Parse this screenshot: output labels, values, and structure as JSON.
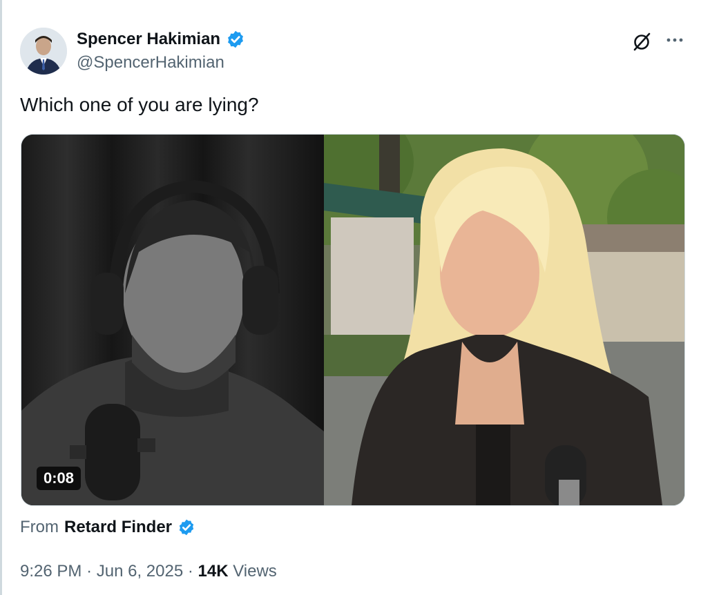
{
  "author": {
    "display_name": "Spencer Hakimian",
    "handle": "@SpencerHakimian",
    "verified": true
  },
  "tweet": {
    "text": "Which one of you are lying?"
  },
  "media": {
    "duration": "0:08"
  },
  "source": {
    "prefix": "From",
    "name": "Retard Finder",
    "verified": true
  },
  "meta": {
    "time": "9:26 PM",
    "sep1": "·",
    "date": "Jun 6, 2025",
    "sep2": "·",
    "views_count": "14K",
    "views_label": "Views"
  },
  "icons": {
    "grok": "grok-icon",
    "more": "more-icon",
    "verified": "verified-icon"
  },
  "colors": {
    "verified_blue": "#1d9bf0",
    "secondary_text": "#536471",
    "primary_text": "#0f1419",
    "border": "#cfd9de"
  }
}
